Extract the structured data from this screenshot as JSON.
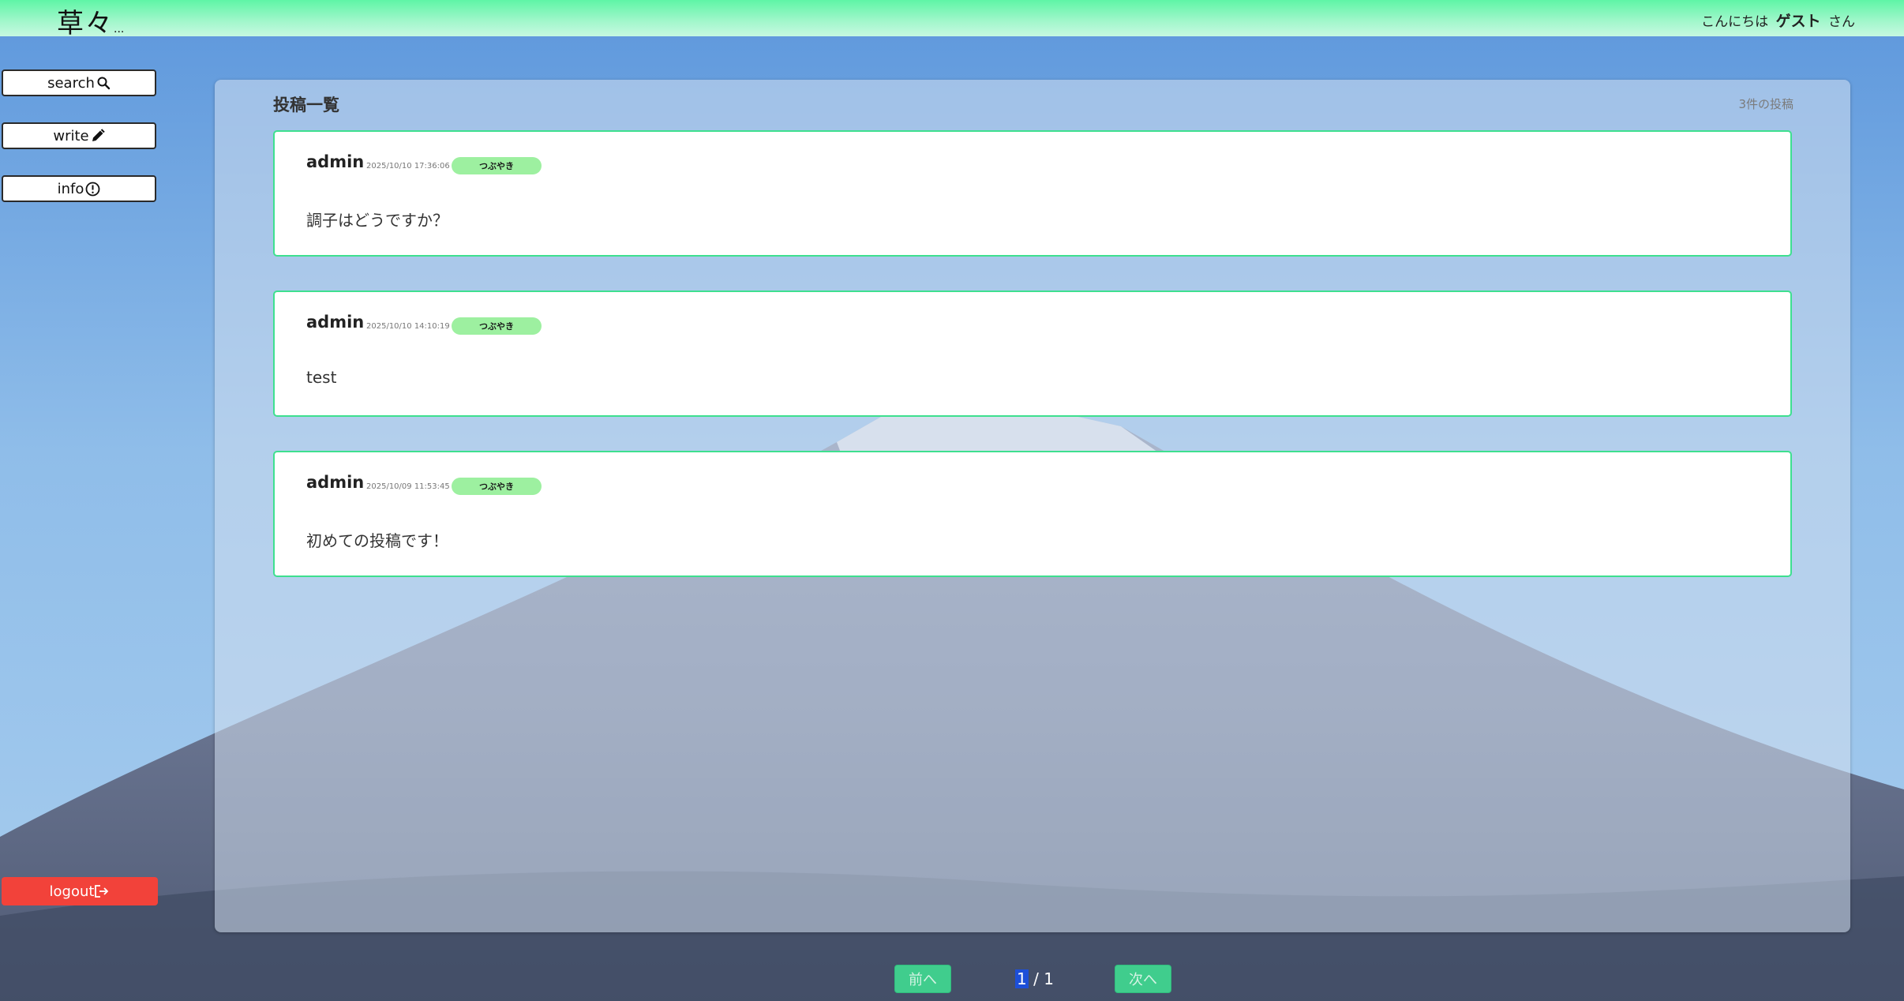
{
  "header": {
    "logo": "草々",
    "logo_suffix": "...",
    "greeting_prefix": "こんにちは",
    "user_name": "ゲスト",
    "greeting_suffix": "さん"
  },
  "sidebar": {
    "items": [
      {
        "label": "search",
        "icon": "search-icon"
      },
      {
        "label": "write",
        "icon": "pencil-icon"
      },
      {
        "label": "info",
        "icon": "info-icon"
      }
    ],
    "logout": {
      "label": "logout",
      "icon": "logout-icon"
    }
  },
  "main": {
    "title": "投稿一覧",
    "post_count": "3件の投稿",
    "posts": [
      {
        "user": "admin",
        "date": "2025/10/10 17:36:06",
        "tag": "つぶやき",
        "body": "調子はどうですか？"
      },
      {
        "user": "admin",
        "date": "2025/10/10 14:10:19",
        "tag": "つぶやき",
        "body": "test"
      },
      {
        "user": "admin",
        "date": "2025/10/09 11:53:45",
        "tag": "つぶやき",
        "body": "初めての投稿です！"
      }
    ]
  },
  "pagination": {
    "prev_label": "前へ",
    "next_label": "次へ",
    "current": "1",
    "separator": " / ",
    "total": "1"
  },
  "colors": {
    "header": "#5ff5a6",
    "accent": "#3ee08f",
    "tag": "#9df0a0",
    "logout": "#f2423a",
    "page_button": "#40cd8d"
  }
}
